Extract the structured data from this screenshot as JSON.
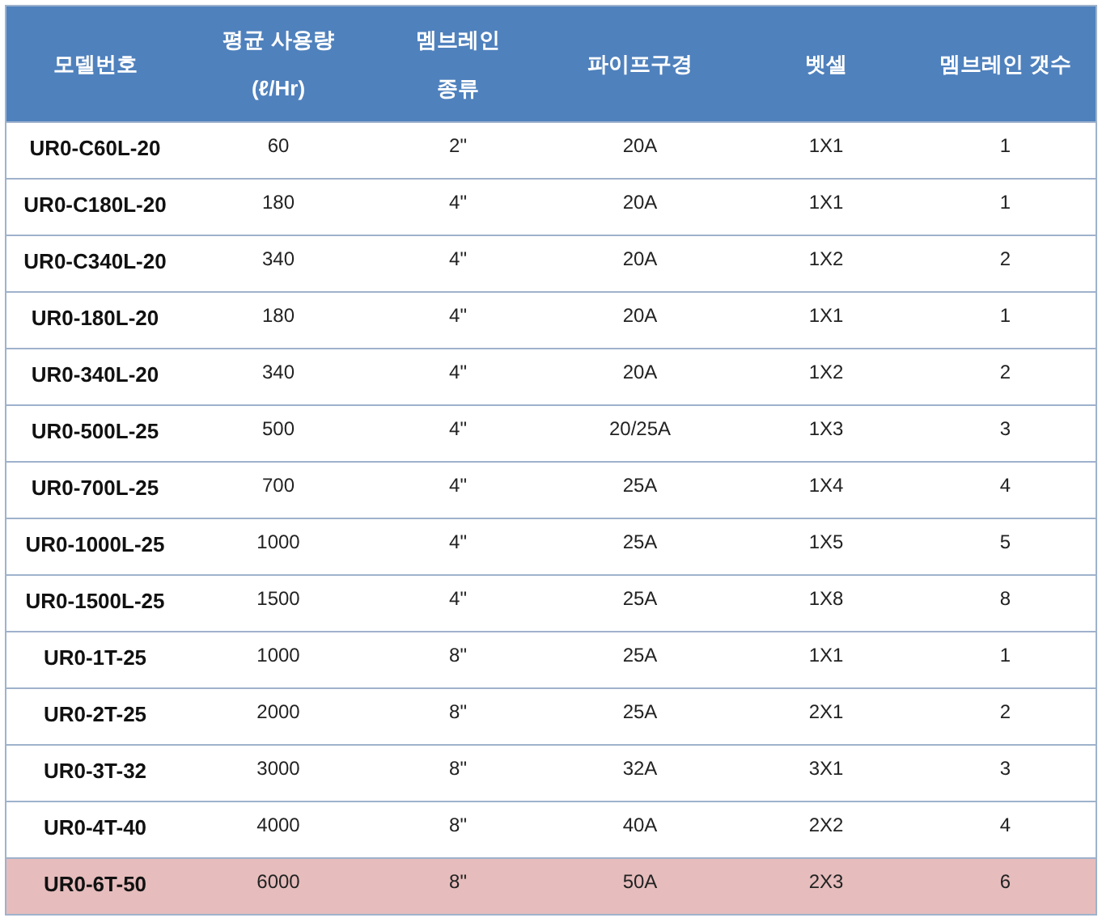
{
  "table": {
    "columns": [
      {
        "lines": [
          "모델번호"
        ]
      },
      {
        "lines": [
          "평균 사용량",
          "(ℓ/Hr)"
        ]
      },
      {
        "lines": [
          "멤브레인",
          "종류"
        ]
      },
      {
        "lines": [
          "파이프구경"
        ]
      },
      {
        "lines": [
          "벳셀"
        ]
      },
      {
        "lines": [
          "멤브레인 갯수"
        ]
      }
    ],
    "rows": [
      {
        "cells": [
          "UR0-C60L-20",
          "60",
          "2\"",
          "20A",
          "1X1",
          "1"
        ],
        "highlighted": false
      },
      {
        "cells": [
          "UR0-C180L-20",
          "180",
          "4\"",
          "20A",
          "1X1",
          "1"
        ],
        "highlighted": false
      },
      {
        "cells": [
          "UR0-C340L-20",
          "340",
          "4\"",
          "20A",
          "1X2",
          "2"
        ],
        "highlighted": false
      },
      {
        "cells": [
          "UR0-180L-20",
          "180",
          "4\"",
          "20A",
          "1X1",
          "1"
        ],
        "highlighted": false
      },
      {
        "cells": [
          "UR0-340L-20",
          "340",
          "4\"",
          "20A",
          "1X2",
          "2"
        ],
        "highlighted": false
      },
      {
        "cells": [
          "UR0-500L-25",
          "500",
          "4\"",
          "20/25A",
          "1X3",
          "3"
        ],
        "highlighted": false
      },
      {
        "cells": [
          "UR0-700L-25",
          "700",
          "4\"",
          "25A",
          "1X4",
          "4"
        ],
        "highlighted": false
      },
      {
        "cells": [
          "UR0-1000L-25",
          "1000",
          "4\"",
          "25A",
          "1X5",
          "5"
        ],
        "highlighted": false
      },
      {
        "cells": [
          "UR0-1500L-25",
          "1500",
          "4\"",
          "25A",
          "1X8",
          "8"
        ],
        "highlighted": false
      },
      {
        "cells": [
          "UR0-1T-25",
          "1000",
          "8\"",
          "25A",
          "1X1",
          "1"
        ],
        "highlighted": false
      },
      {
        "cells": [
          "UR0-2T-25",
          "2000",
          "8\"",
          "25A",
          "2X1",
          "2"
        ],
        "highlighted": false
      },
      {
        "cells": [
          "UR0-3T-32",
          "3000",
          "8\"",
          "32A",
          "3X1",
          "3"
        ],
        "highlighted": false
      },
      {
        "cells": [
          "UR0-4T-40",
          "4000",
          "8\"",
          "40A",
          "2X2",
          "4"
        ],
        "highlighted": false
      },
      {
        "cells": [
          "UR0-6T-50",
          "6000",
          "8\"",
          "50A",
          "2X3",
          "6"
        ],
        "highlighted": true
      }
    ]
  }
}
